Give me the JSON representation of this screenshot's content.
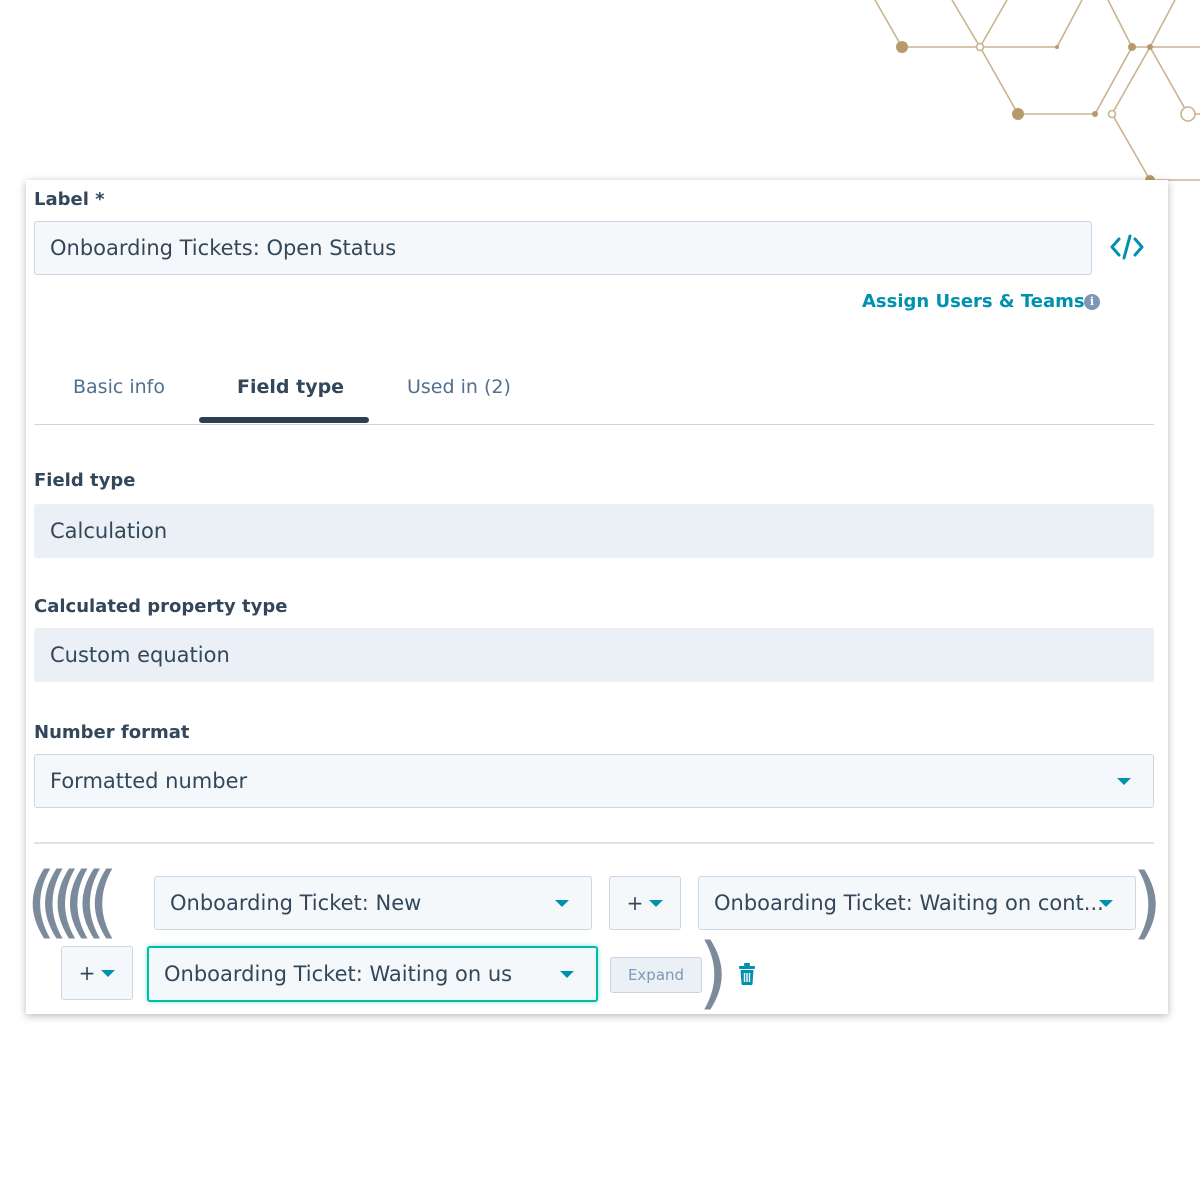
{
  "label": {
    "title": "Label *",
    "value": "Onboarding Tickets: Open Status",
    "code_icon": "code-brackets-icon"
  },
  "assign": {
    "link": "Assign Users & Teams",
    "info_icon": "info-icon",
    "info_glyph": "i"
  },
  "tabs": [
    {
      "label": "Basic info",
      "active": false
    },
    {
      "label": "Field type",
      "active": true
    },
    {
      "label": "Used in (2)",
      "active": false
    }
  ],
  "field_type": {
    "title": "Field type",
    "value": "Calculation"
  },
  "calc_type": {
    "title": "Calculated property type",
    "value": "Custom equation"
  },
  "number_format": {
    "title": "Number format",
    "value": "Formatted number"
  },
  "equation": {
    "open_parens": "((((((",
    "close_paren": ")",
    "row1": {
      "property_a": "Onboarding Ticket: New",
      "operator": "+",
      "property_b": "Onboarding Ticket: Waiting on cont..."
    },
    "row2": {
      "operator": "+",
      "property": "Onboarding Ticket: Waiting on us",
      "expand_label": "Expand",
      "delete_icon": "trash-icon"
    }
  },
  "colors": {
    "accent": "#0091ae",
    "focus": "#00bda5",
    "text": "#33475b",
    "border": "#cbd6e2",
    "readonly_bg": "#eaf0f6",
    "decor_gold": "#b89a6a"
  }
}
